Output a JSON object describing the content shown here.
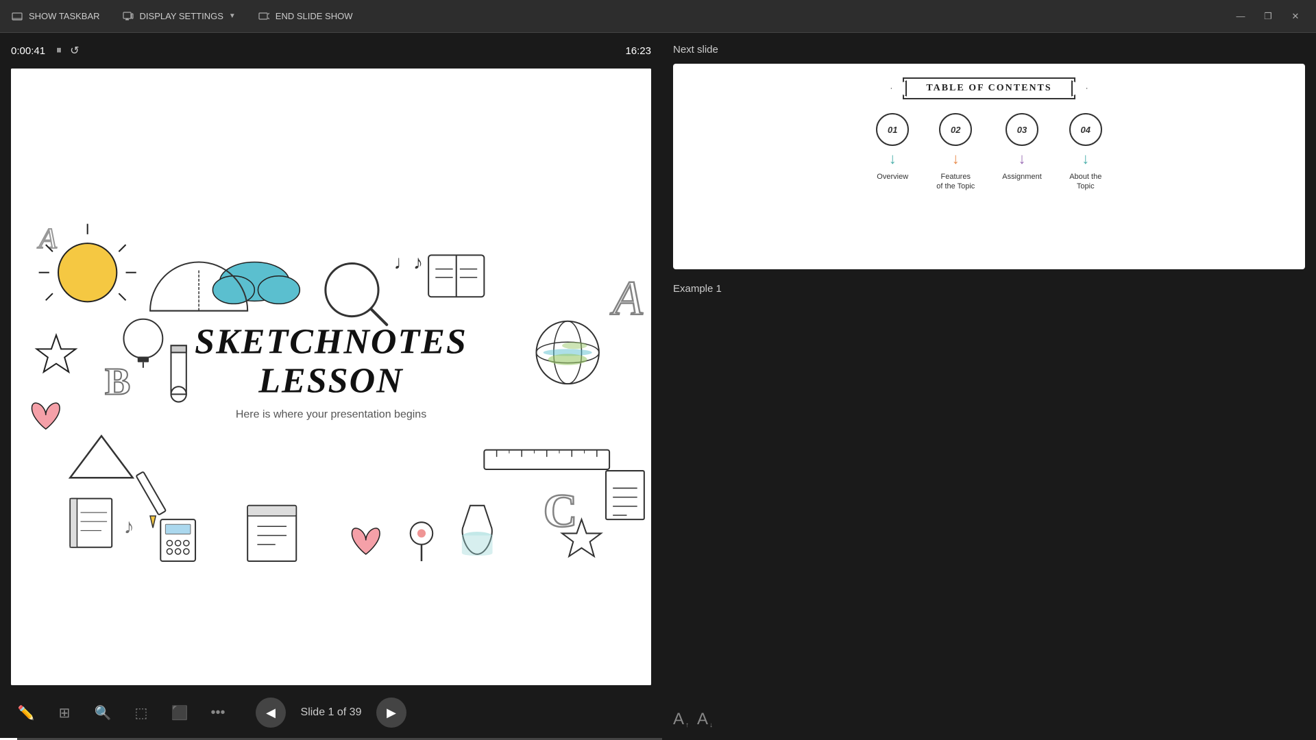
{
  "toolbar": {
    "show_taskbar_label": "SHOW TASKBAR",
    "display_settings_label": "DISPLAY SETTINGS",
    "end_slideshow_label": "END SLIDE SHOW"
  },
  "timer": {
    "elapsed": "0:00:41",
    "clock": "16:23"
  },
  "slide": {
    "title_line1": "SKETCHNOTES",
    "title_line2": "LESSON",
    "subtitle": "Here is where your presentation begins",
    "counter": "Slide 1 of 39",
    "current": 1,
    "total": 39
  },
  "next_slide": {
    "label": "Next slide",
    "toc_title": "TABLE OF CONTENTS",
    "items": [
      {
        "number": "01",
        "label": "Overview"
      },
      {
        "number": "02",
        "label": "Features\nof the Topic"
      },
      {
        "number": "03",
        "label": "Assignment"
      },
      {
        "number": "04",
        "label": "About the\nTopic"
      }
    ]
  },
  "example": {
    "label": "Example 1"
  },
  "tools": {
    "pen_label": "Pen",
    "grid_label": "Grid",
    "zoom_label": "Zoom",
    "select_label": "Select",
    "screen_label": "Screen",
    "more_label": "More"
  },
  "nav": {
    "prev_label": "Previous",
    "next_label": "Next"
  },
  "window": {
    "minimize": "—",
    "restore": "❐",
    "close": "✕"
  }
}
